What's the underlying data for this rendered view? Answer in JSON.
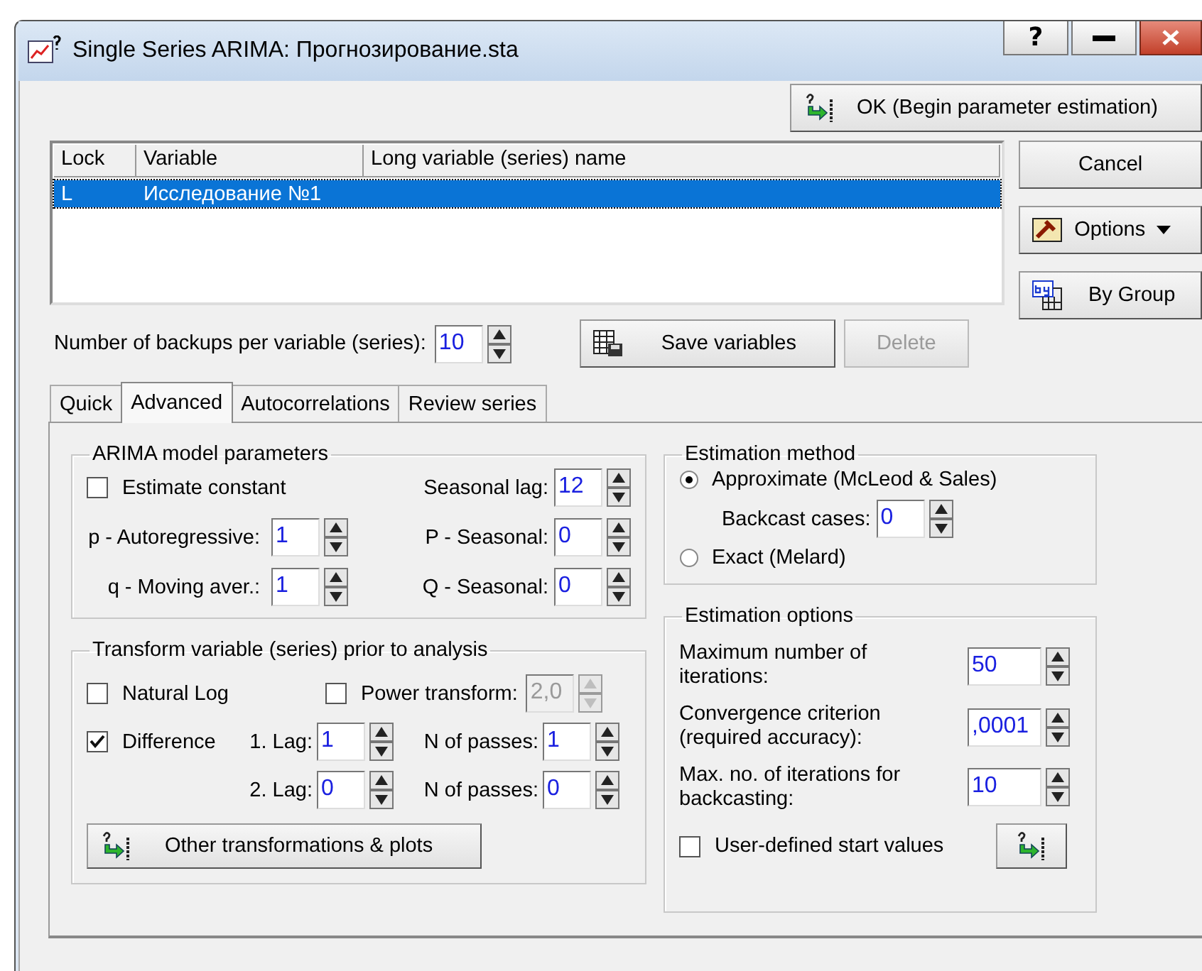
{
  "window": {
    "title": "Single Series ARIMA: Прогнозирование.sta",
    "help_button": "?"
  },
  "ok_button": "OK (Begin parameter estimation)",
  "variable_list": {
    "columns": [
      "Lock",
      "Variable",
      "Long variable (series) name"
    ],
    "rows": [
      {
        "lock": "L",
        "variable": "Исследование №1",
        "selected": true
      }
    ]
  },
  "side_buttons": [
    {
      "kind": "plain",
      "label": "Cancel"
    },
    {
      "kind": "options",
      "label": "Options"
    },
    {
      "kind": "group",
      "label": "By Group"
    }
  ],
  "backups": {
    "label": "Number of backups per variable (series):",
    "value": "10"
  },
  "save_button": "Save variables",
  "delete_button": {
    "label": "Delete",
    "disabled": true
  },
  "tabs": [
    {
      "label": "Quick",
      "selected": false
    },
    {
      "label": "Advanced",
      "selected": true
    },
    {
      "label": "Autocorrelations",
      "selected": false
    },
    {
      "label": "Review series",
      "selected": false
    }
  ],
  "arima": {
    "title": "ARIMA model parameters",
    "estimate_constant": {
      "label": "Estimate constant",
      "checked": false
    },
    "seasonal_lag": {
      "label": "Seasonal lag:",
      "value": "12"
    },
    "rows": [
      {
        "label": "p - Autoregressive:",
        "value": "1",
        "seasonal_label": "P - Seasonal:",
        "seasonal_value": "0"
      },
      {
        "label": "q - Moving aver.:",
        "value": "1",
        "seasonal_label": "Q - Seasonal:",
        "seasonal_value": "0"
      }
    ]
  },
  "transform": {
    "title": "Transform variable (series) prior to analysis",
    "natural_log": {
      "label": "Natural Log",
      "checked": false
    },
    "power": {
      "label": "Power transform:",
      "checked": false,
      "value": "2,0",
      "disabled": true
    },
    "difference": {
      "label": "Difference",
      "checked": true
    },
    "lags": [
      {
        "lag_label": "1. Lag:",
        "lag": "1",
        "passes_label": "N of passes:",
        "passes": "1"
      },
      {
        "lag_label": "2. Lag:",
        "lag": "0",
        "passes_label": "N of passes:",
        "passes": "0"
      }
    ],
    "button": "Other transformations & plots"
  },
  "method": {
    "title": "Estimation method",
    "options": [
      {
        "label": "Approximate (McLeod & Sales)",
        "selected": true
      },
      {
        "label": "Exact (Melard)",
        "selected": false
      }
    ],
    "backcast": {
      "label": "Backcast cases:",
      "value": "0"
    }
  },
  "options": {
    "title": "Estimation options",
    "fields": [
      {
        "label": "Maximum number of iterations:",
        "value": "50"
      },
      {
        "label": "Convergence criterion (required accuracy):",
        "value": ",0001"
      },
      {
        "label": "Max. no. of iterations for backcasting:",
        "value": "10"
      }
    ],
    "user_defined": {
      "label": "User-defined start values",
      "checked": false
    }
  }
}
